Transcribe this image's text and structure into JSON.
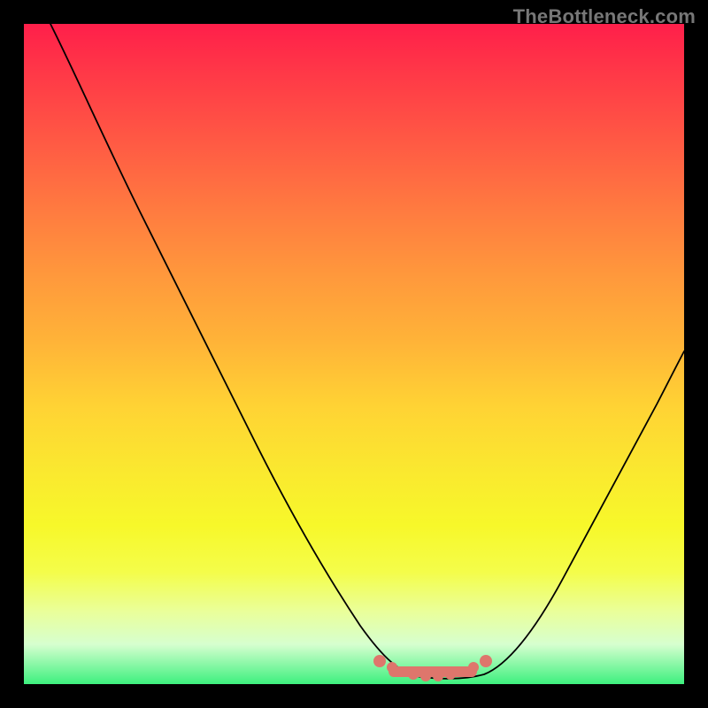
{
  "watermark": "TheBottleneck.com",
  "chart_data": {
    "type": "line",
    "title": "",
    "xlabel": "",
    "ylabel": "",
    "xlim": [
      0,
      100
    ],
    "ylim": [
      0,
      100
    ],
    "grid": false,
    "legend": false,
    "background": "vertical-gradient red-to-green",
    "series": [
      {
        "name": "bottleneck-curve",
        "x": [
          0,
          4,
          8,
          12,
          16,
          20,
          24,
          28,
          32,
          36,
          40,
          44,
          48,
          52,
          55,
          58,
          61,
          63,
          66,
          70,
          74,
          78,
          82,
          86,
          90,
          94,
          98,
          100
        ],
        "y": [
          100,
          95,
          88,
          81,
          74,
          66,
          58,
          50,
          42,
          35,
          28,
          21,
          15,
          9,
          5,
          2.5,
          1.2,
          0.8,
          0.8,
          1.2,
          3,
          8,
          15,
          23,
          31,
          39,
          47,
          51
        ]
      }
    ],
    "markers": {
      "name": "optimal-range",
      "x": [
        55,
        57,
        59,
        61,
        63,
        65,
        67,
        70
      ],
      "y": [
        3.2,
        2.2,
        1.6,
        1.2,
        1.0,
        1.0,
        1.2,
        1.8
      ]
    },
    "colors": {
      "curve": "#000000",
      "markers": "#de766c",
      "gradient_top": "#ff1f4a",
      "gradient_bottom": "#3df07e"
    }
  }
}
